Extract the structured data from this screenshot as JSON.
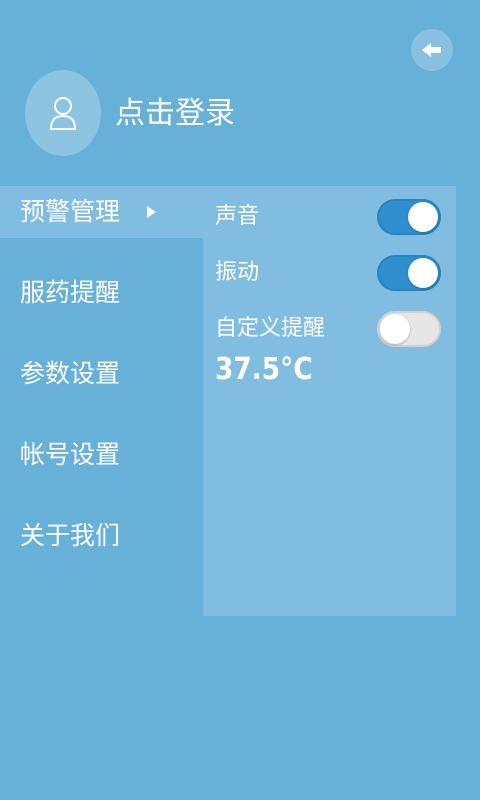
{
  "header": {
    "back_icon": "arrow-left-icon",
    "avatar_icon": "user-icon",
    "login_label": "点击登录"
  },
  "menu": {
    "items": [
      {
        "label": "预警管理",
        "active": true
      },
      {
        "label": "服药提醒",
        "active": false
      },
      {
        "label": "参数设置",
        "active": false
      },
      {
        "label": "帐号设置",
        "active": false
      },
      {
        "label": "关于我们",
        "active": false
      }
    ]
  },
  "panel": {
    "sound": {
      "label": "声音",
      "enabled": true
    },
    "vibration": {
      "label": "振动",
      "enabled": true
    },
    "custom": {
      "label": "自定义提醒",
      "enabled": false
    },
    "temperature": "37.5°C"
  },
  "colors": {
    "background": "#67b0d8",
    "panel": "#80bde0",
    "toggle_on": "#2f8ecd",
    "toggle_off": "#e6e6e6"
  }
}
